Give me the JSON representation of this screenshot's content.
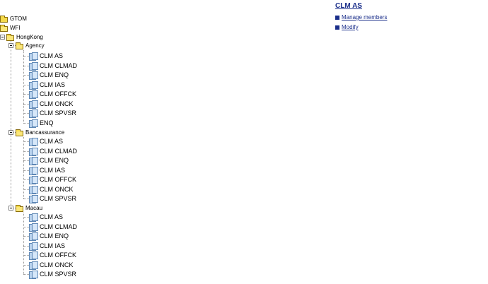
{
  "tree": {
    "roots": [
      {
        "label": "GTOM"
      },
      {
        "label": "WFI"
      }
    ],
    "region": {
      "label": "HongKong"
    },
    "groups": [
      {
        "label": "Agency",
        "items": [
          "CLM AS",
          "CLM CLMAD",
          "CLM ENQ",
          "CLM IAS",
          "CLM OFFCK",
          "CLM ONCK",
          "CLM SPVSR",
          "ENQ"
        ]
      },
      {
        "label": "Bancassurance",
        "items": [
          "CLM AS",
          "CLM CLMAD",
          "CLM ENQ",
          "CLM IAS",
          "CLM OFFCK",
          "CLM ONCK",
          "CLM SPVSR"
        ]
      },
      {
        "label": "Macau",
        "items": [
          "CLM AS",
          "CLM CLMAD",
          "CLM ENQ",
          "CLM IAS",
          "CLM OFFCK",
          "CLM ONCK",
          "CLM SPVSR"
        ]
      }
    ]
  },
  "panel": {
    "title": "CLM AS",
    "actions": [
      {
        "label": "Manage members"
      },
      {
        "label": "Modify"
      }
    ]
  }
}
